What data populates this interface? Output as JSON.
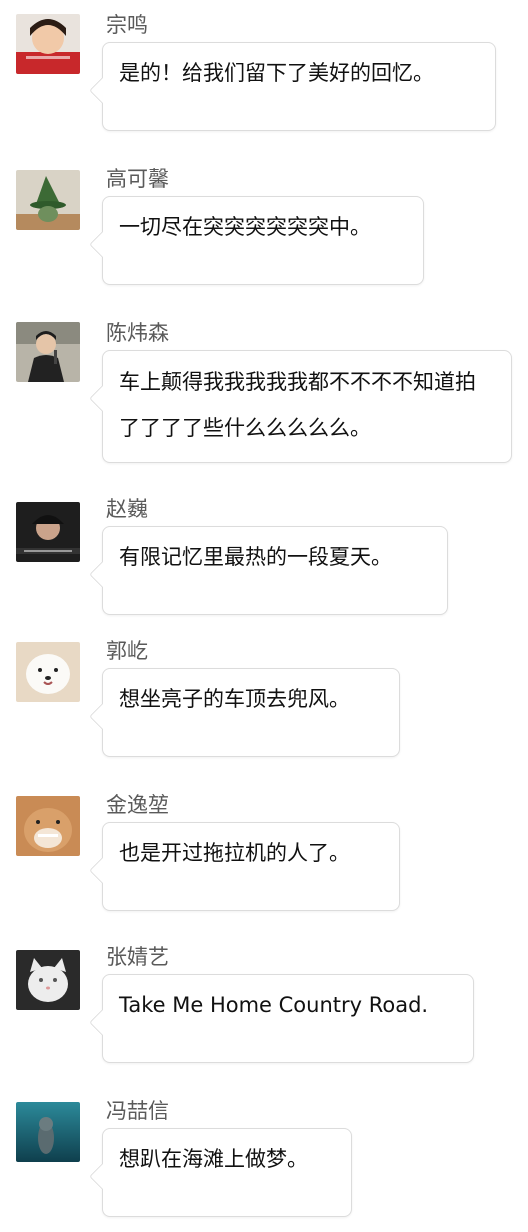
{
  "messages": [
    {
      "sender": "宗鸣",
      "text": "是的！给我们留下了美好的回忆。",
      "avatar": "girl-red-sweater-avatar"
    },
    {
      "sender": "高可馨",
      "text": "一切尽在突突突突突突中。",
      "avatar": "green-hat-figure-avatar"
    },
    {
      "sender": "陈炜森",
      "text": "车上颠得我我我我我都不不不不知道拍了了了了些什么么么么么。",
      "avatar": "singer-microphone-avatar"
    },
    {
      "sender": "赵巍",
      "text": "有限记忆里最热的一段夏天。",
      "avatar": "man-in-cap-avatar"
    },
    {
      "sender": "郭屹",
      "text": "想坐亮子的车顶去兜风。",
      "avatar": "samoyed-dog-avatar"
    },
    {
      "sender": "金逸堃",
      "text": "也是开过拖拉机的人了。",
      "avatar": "shiba-dog-avatar"
    },
    {
      "sender": "张婧艺",
      "text": "Take Me Home Country Road.",
      "avatar": "white-cat-avatar"
    },
    {
      "sender": "冯喆信",
      "text": "想趴在海滩上做梦。",
      "avatar": "seal-underwater-avatar"
    }
  ]
}
